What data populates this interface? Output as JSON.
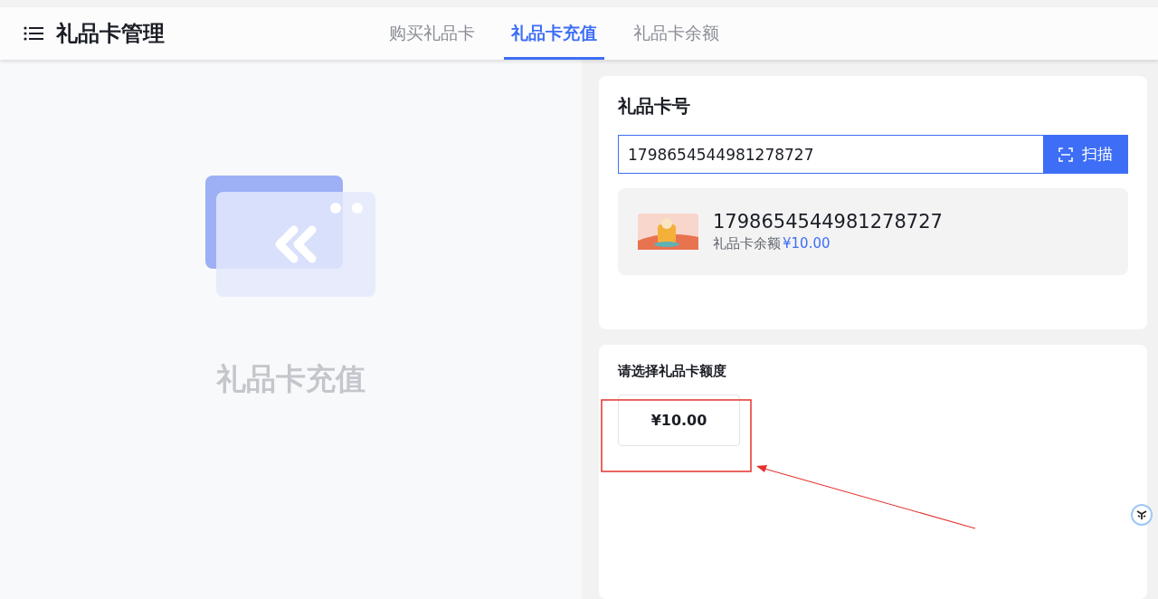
{
  "header": {
    "title": "礼品卡管理",
    "tabs": [
      {
        "label": "购买礼品卡",
        "selected": false
      },
      {
        "label": "礼品卡充值",
        "selected": true
      },
      {
        "label": "礼品卡余额",
        "selected": false
      }
    ]
  },
  "left_panel": {
    "caption": "礼品卡充值"
  },
  "card_number": {
    "title": "礼品卡号",
    "value": "1798654544981278727",
    "scan_button": "扫描"
  },
  "card_result": {
    "number": "1798654544981278727",
    "balance_label": "礼品卡余额",
    "balance_value": "¥10.00"
  },
  "amount": {
    "title": "请选择礼品卡额度",
    "options": [
      {
        "label": "¥10.00",
        "selected": false
      }
    ]
  }
}
